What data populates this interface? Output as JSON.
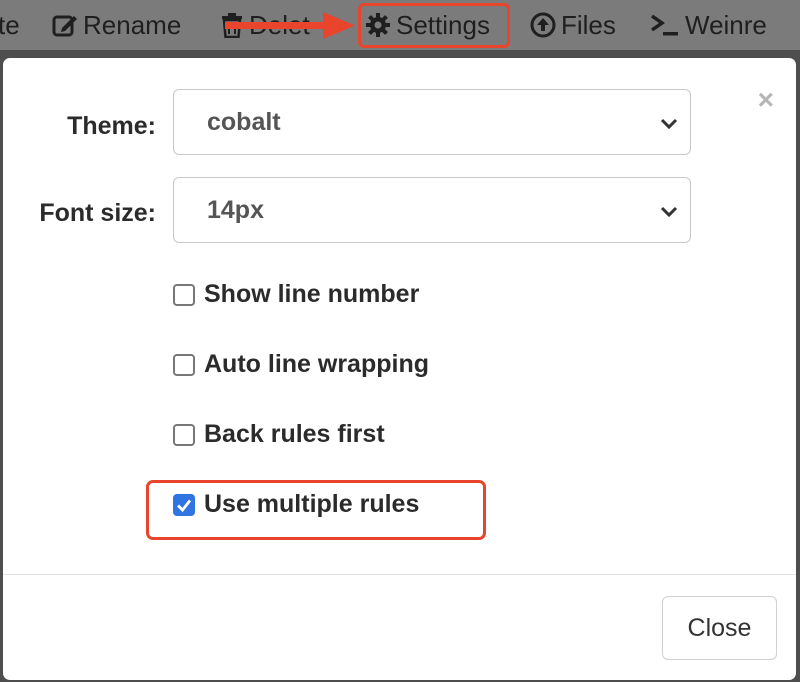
{
  "toolbar": {
    "items": [
      {
        "label": "te",
        "icon": null
      },
      {
        "label": "Rename",
        "icon": "edit-icon"
      },
      {
        "label": "Delet",
        "icon": "trash-icon"
      },
      {
        "label": "Settings",
        "icon": "gear-icon"
      },
      {
        "label": "Files",
        "icon": "upload-circle-icon"
      },
      {
        "label": "Weinre",
        "icon": "terminal-icon"
      }
    ]
  },
  "modal": {
    "close_glyph": "×",
    "theme": {
      "label": "Theme:",
      "value": "cobalt"
    },
    "font_size": {
      "label": "Font size:",
      "value": "14px"
    },
    "options": [
      {
        "label": "Show line number",
        "checked": false
      },
      {
        "label": "Auto line wrapping",
        "checked": false
      },
      {
        "label": "Back rules first",
        "checked": false
      },
      {
        "label": "Use multiple rules",
        "checked": true
      }
    ],
    "close_button": "Close"
  },
  "colors": {
    "highlight": "#e8452c",
    "checkbox_checked": "#2f74e0"
  }
}
